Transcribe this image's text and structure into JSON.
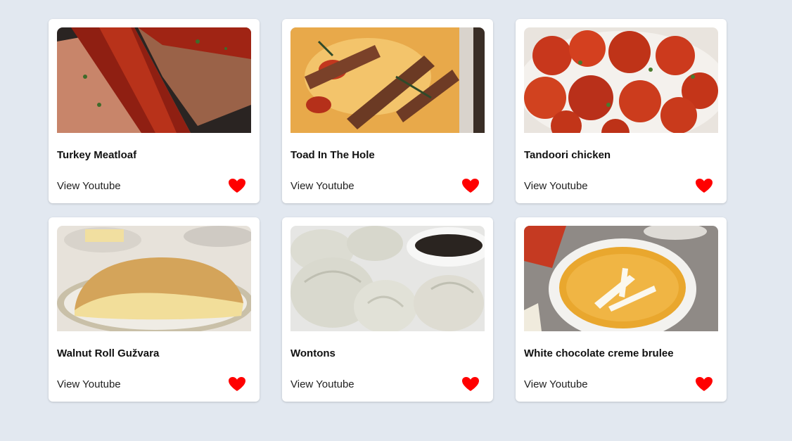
{
  "accent_color": "#ff0000",
  "cards": [
    {
      "title": "Turkey Meatloaf",
      "link_label": "View Youtube",
      "favorite_icon": "heart-icon"
    },
    {
      "title": "Toad In The Hole",
      "link_label": "View Youtube",
      "favorite_icon": "heart-icon"
    },
    {
      "title": "Tandoori chicken",
      "link_label": "View Youtube",
      "favorite_icon": "heart-icon"
    },
    {
      "title": "Walnut Roll Gužvara",
      "link_label": "View Youtube",
      "favorite_icon": "heart-icon"
    },
    {
      "title": "Wontons",
      "link_label": "View Youtube",
      "favorite_icon": "heart-icon"
    },
    {
      "title": "White chocolate creme brulee",
      "link_label": "View Youtube",
      "favorite_icon": "heart-icon"
    }
  ]
}
